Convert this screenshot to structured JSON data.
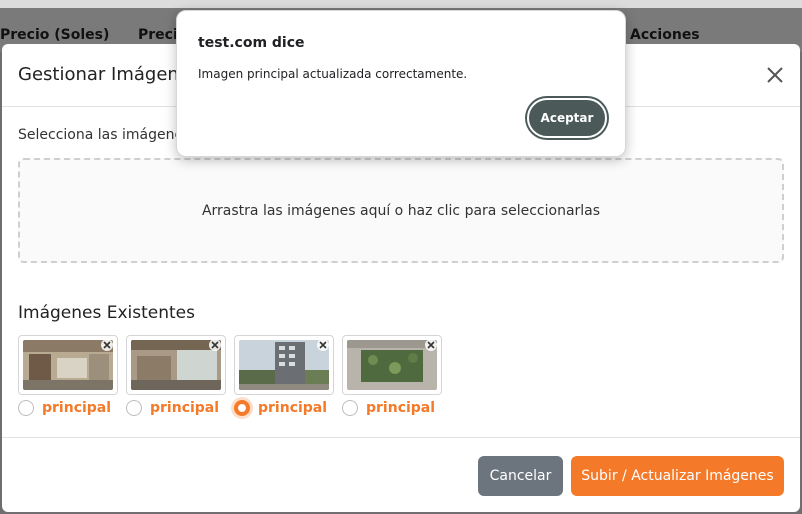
{
  "background_table": {
    "columns": [
      "Precio (Soles)",
      "Precio",
      "Acciones"
    ]
  },
  "alert": {
    "origin": "test.com dice",
    "message": "Imagen principal actualizada correctamente.",
    "ok_label": "Aceptar"
  },
  "modal": {
    "title": "Gestionar Imágenes",
    "close_icon": "close-icon",
    "select_label": "Selecciona las imágenes",
    "dropzone_text": "Arrastra las imágenes aquí o haz clic para seleccionarlas",
    "existing_title": "Imágenes Existentes",
    "images": [
      {
        "label": "principal",
        "selected": false,
        "remove_icon": "close-icon"
      },
      {
        "label": "principal",
        "selected": false,
        "remove_icon": "close-icon"
      },
      {
        "label": "principal",
        "selected": true,
        "remove_icon": "close-icon"
      },
      {
        "label": "principal",
        "selected": false,
        "remove_icon": "close-icon"
      }
    ],
    "cancel_label": "Cancelar",
    "submit_label": "Subir / Actualizar Imágenes"
  },
  "colors": {
    "accent": "#f47a2a",
    "cancel": "#6c757d",
    "alert_button": "#4b5a59"
  }
}
